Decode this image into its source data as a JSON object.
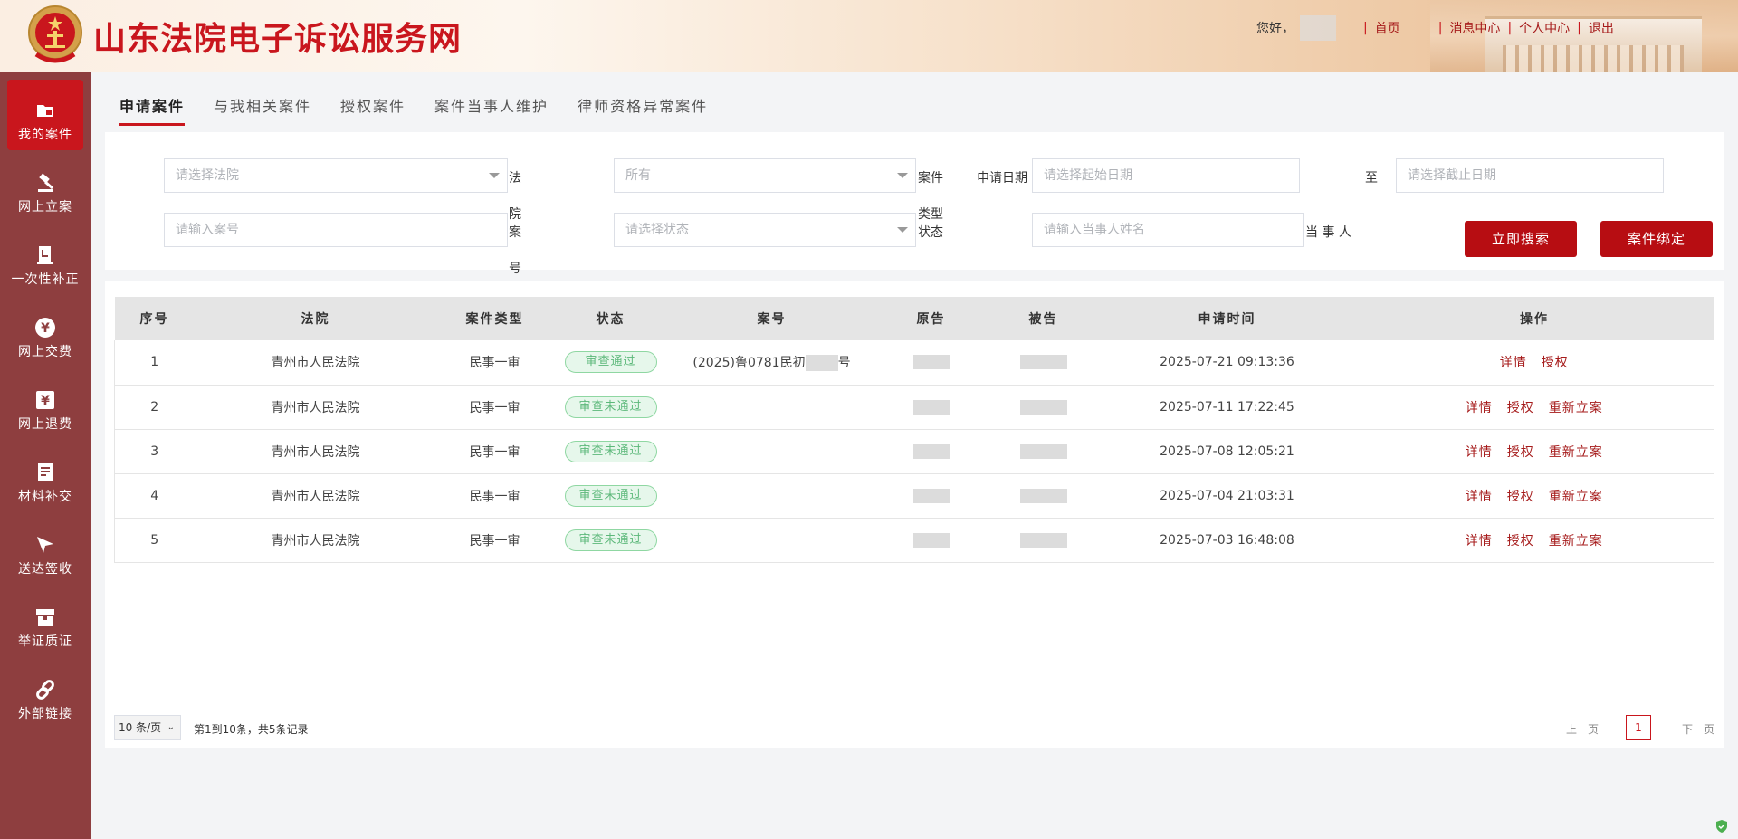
{
  "header": {
    "site_title": "山东法院电子诉讼服务网",
    "greeting": "您好，",
    "nav": [
      "首页",
      "消息中心",
      "个人中心",
      "退出"
    ]
  },
  "sidebar": {
    "items": [
      {
        "label": "我的案件",
        "icon": "folder-icon",
        "active": true
      },
      {
        "label": "网上立案",
        "icon": "gavel-icon"
      },
      {
        "label": "一次性补正",
        "icon": "document-edit-icon"
      },
      {
        "label": "网上交费",
        "icon": "yuan-coin-icon"
      },
      {
        "label": "网上退费",
        "icon": "yuan-refund-icon"
      },
      {
        "label": "材料补交",
        "icon": "document-icon"
      },
      {
        "label": "送达签收",
        "icon": "send-icon"
      },
      {
        "label": "举证质证",
        "icon": "evidence-box-icon"
      },
      {
        "label": "外部链接",
        "icon": "link-icon"
      }
    ]
  },
  "tabs": [
    "申请案件",
    "与我相关案件",
    "授权案件",
    "案件当事人维护",
    "律师资格异常案件"
  ],
  "search": {
    "court_placeholder": "请选择法院",
    "court_label_1": "法",
    "court_label_2": "院",
    "case_label_1": "案",
    "case_label_2": "号",
    "case_type_value": "所有",
    "case_type_label": "案件",
    "case_type_label_2": "类型",
    "status_label": "状态",
    "date_label": "申请日期",
    "start_date_placeholder": "请选择起始日期",
    "to_label": "至",
    "end_date_placeholder": "请选择截止日期",
    "case_no_placeholder": "请输入案号",
    "status_placeholder": "请选择状态",
    "party_placeholder": "请输入当事人姓名",
    "party_label": "当 事 人",
    "search_button": "立即搜索",
    "bind_button": "案件绑定"
  },
  "table": {
    "headers": [
      "序号",
      "法院",
      "案件类型",
      "状态",
      "案号",
      "原告",
      "被告",
      "申请时间",
      "操作"
    ],
    "rows": [
      {
        "no": "1",
        "court": "青州市人民法院",
        "type": "民事一审",
        "status": "审查通过",
        "case_no_prefix": "(2025)鲁0781民初",
        "case_no_suffix": "号",
        "time": "2025-07-21 09:13:36",
        "ops": [
          "详情",
          "授权"
        ]
      },
      {
        "no": "2",
        "court": "青州市人民法院",
        "type": "民事一审",
        "status": "审查未通过",
        "time": "2025-07-11 17:22:45",
        "ops": [
          "详情",
          "授权",
          "重新立案"
        ]
      },
      {
        "no": "3",
        "court": "青州市人民法院",
        "type": "民事一审",
        "status": "审查未通过",
        "time": "2025-07-08 12:05:21",
        "ops": [
          "详情",
          "授权",
          "重新立案"
        ]
      },
      {
        "no": "4",
        "court": "青州市人民法院",
        "type": "民事一审",
        "status": "审查未通过",
        "time": "2025-07-04 21:03:31",
        "ops": [
          "详情",
          "授权",
          "重新立案"
        ]
      },
      {
        "no": "5",
        "court": "青州市人民法院",
        "type": "民事一审",
        "status": "审查未通过",
        "time": "2025-07-03 16:48:08",
        "ops": [
          "详情",
          "授权",
          "重新立案"
        ]
      }
    ]
  },
  "pagination": {
    "page_size": "10 条/页",
    "info": "第1到10条，共5条记录",
    "prev": "上一页",
    "current": "1",
    "next": "下一页"
  },
  "colors": {
    "brand_red": "#c9161d",
    "sidebar_bg": "#8e3e3f",
    "button_red": "#b70d12",
    "status_green": "#5cb87a"
  }
}
